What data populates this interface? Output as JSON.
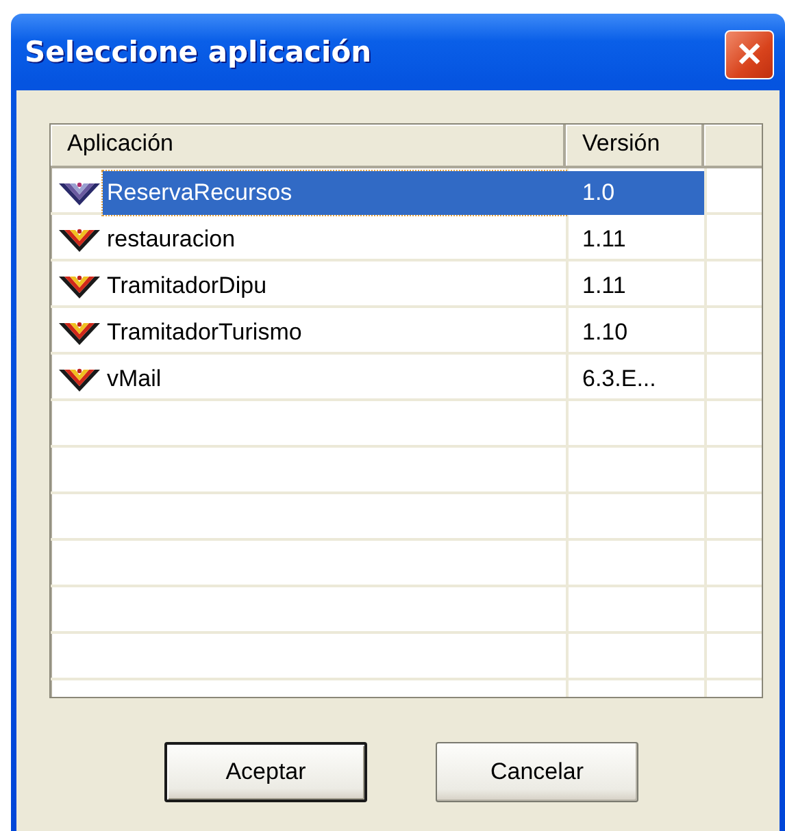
{
  "window": {
    "title": "Seleccione aplicación",
    "close": "✕"
  },
  "table": {
    "columns": [
      "Aplicación",
      "Versión"
    ],
    "rows": [
      {
        "name": "ReservaRecursos",
        "version": "1.0",
        "selected": true
      },
      {
        "name": "restauracion",
        "version": "1.11",
        "selected": false
      },
      {
        "name": "TramitadorDipu",
        "version": "1.11",
        "selected": false
      },
      {
        "name": "TramitadorTurismo",
        "version": "1.10",
        "selected": false
      },
      {
        "name": "vMail",
        "version": "6.3.E...",
        "selected": false
      }
    ]
  },
  "buttons": [
    {
      "label": "Aceptar",
      "default": true
    },
    {
      "label": "Cancelar",
      "default": false
    }
  ]
}
